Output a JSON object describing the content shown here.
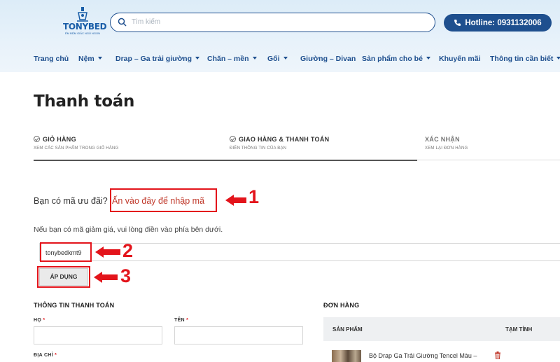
{
  "header": {
    "logo": {
      "brand": "TONYBED",
      "tagline": "ÊM ĐỆM GIẤC NGỦ NGON"
    },
    "search": {
      "placeholder": "Tìm kiếm"
    },
    "hotline": {
      "label": "Hotline: 0931132006"
    },
    "nav": [
      {
        "label": "Trang chủ",
        "has_dropdown": false
      },
      {
        "label": "Nệm",
        "has_dropdown": true
      },
      {
        "label": "Drap – Ga trải giường",
        "has_dropdown": true
      },
      {
        "label": "Chăn – mền",
        "has_dropdown": true
      },
      {
        "label": "Gối",
        "has_dropdown": true
      },
      {
        "label": "Giường – Divan",
        "has_dropdown": false
      },
      {
        "label": "Sản phẩm cho bé",
        "has_dropdown": true
      },
      {
        "label": "Khuyến mãi",
        "has_dropdown": false
      },
      {
        "label": "Thông tin cần biết",
        "has_dropdown": true
      }
    ]
  },
  "page": {
    "title": "Thanh toán"
  },
  "steps": [
    {
      "title": "GIỎ HÀNG",
      "subtitle": "XEM CÁC SẢN PHẨM TRONG GIỎ HÀNG",
      "done": true
    },
    {
      "title": "GIAO HÀNG & THANH TOÁN",
      "subtitle": "ĐIỀN THÔNG TIN CỦA BẠN",
      "done": true
    },
    {
      "title": "XÁC NHẬN",
      "subtitle": "XEM LẠI ĐƠN HÀNG",
      "done": false
    }
  ],
  "coupon": {
    "question": "Bạn có mã ưu đãi?",
    "link": "Ấn vào đây để nhập mã",
    "help": "Nếu bạn có mã giảm giá, vui lòng điền vào phía bên dưới.",
    "code_value": "tonybedkmt9",
    "apply_label": "ÁP DỤNG"
  },
  "annotations": {
    "n1": "1",
    "n2": "2",
    "n3": "3",
    "color": "#e3141b"
  },
  "billing": {
    "title": "THÔNG TIN THANH TOÁN",
    "last_name_label": "HỌ",
    "first_name_label": "TÊN",
    "address_label": "ĐỊA CHỈ",
    "required_mark": "*"
  },
  "order": {
    "title": "ĐƠN HÀNG",
    "col_product": "SẢN PHẨM",
    "col_subtotal": "TẠM TÍNH",
    "items": [
      {
        "name": "Bộ Drap Ga Trải Giường Tencel Màu –"
      }
    ]
  },
  "colors": {
    "brand_blue": "#1e4f8e",
    "accent_red": "#c0392b"
  }
}
